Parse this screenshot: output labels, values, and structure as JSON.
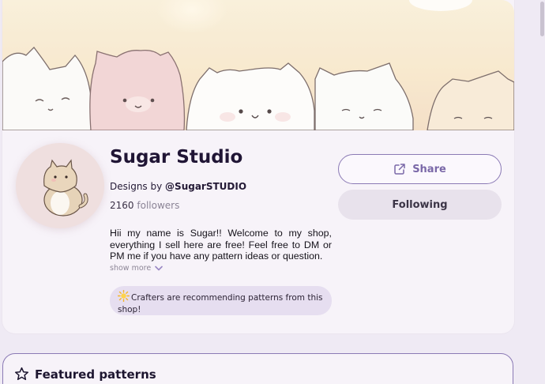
{
  "shop": {
    "name": "Sugar Studio",
    "designs_by_prefix": "Designs by",
    "handle": "@SugarSTUDIO",
    "followers_count": "2160",
    "followers_label": "followers",
    "bio": "Hii my name is Sugar!! Welcome to my shop, everything I sell here are free! Feel free to DM or PM me if you have any pattern ideas or question.",
    "show_more_label": "show more",
    "recommend_text": "Crafters are recommending patterns from this shop!"
  },
  "actions": {
    "share_label": "Share",
    "following_label": "Following"
  },
  "featured": {
    "title": "Featured patterns"
  },
  "icons": {
    "share": "share-external-icon",
    "chevron": "chevron-down-icon",
    "sun": "sun-sparkle-icon",
    "star": "star-outline-icon"
  },
  "colors": {
    "accent": "#8b7ab5",
    "page_background": "#efeaf4",
    "card_background": "#f7f3f9",
    "badge_background": "#e6def0",
    "following_background": "#e8e2ec"
  }
}
